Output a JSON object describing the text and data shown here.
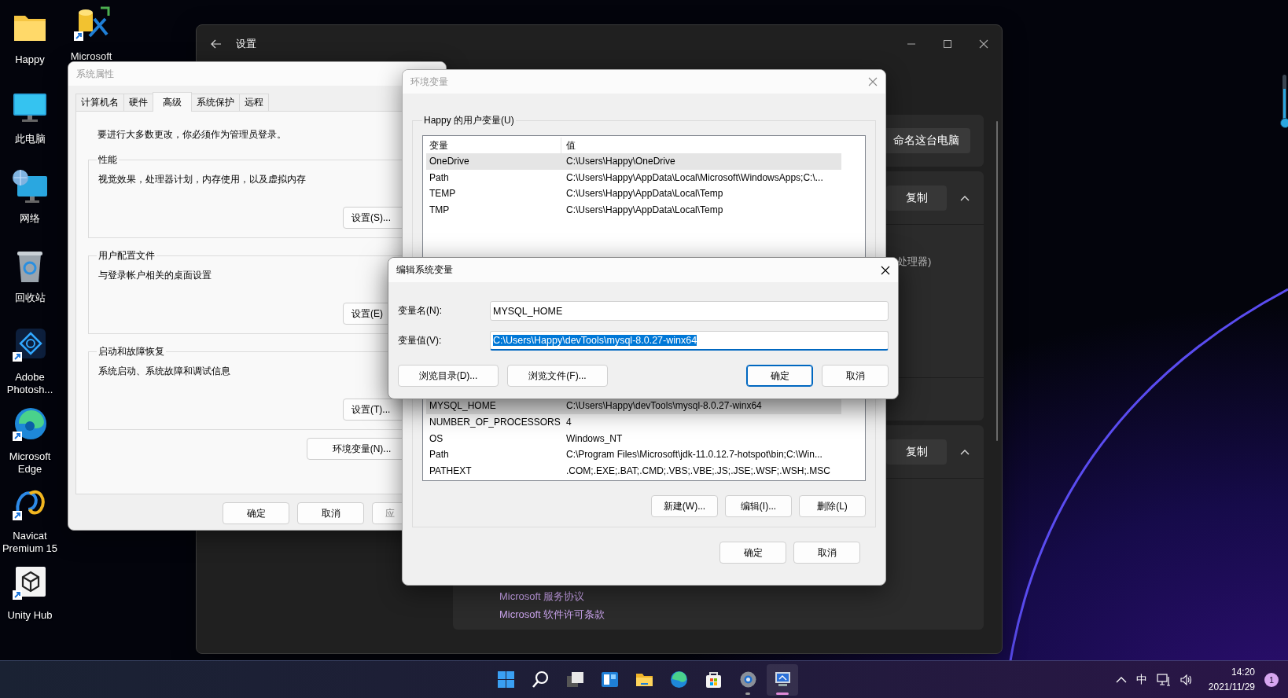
{
  "desktop_icons": [
    {
      "label": "Happy",
      "kind": "folder",
      "shortcut": false
    },
    {
      "label": "此电脑",
      "kind": "computer",
      "shortcut": false
    },
    {
      "label": "网络",
      "kind": "network",
      "shortcut": false
    },
    {
      "label": "回收站",
      "kind": "recycle-bin",
      "shortcut": false
    },
    {
      "label": "Adobe Photosh...",
      "kind": "photoshop",
      "shortcut": true
    },
    {
      "label": "Microsoft Edge",
      "kind": "edge",
      "shortcut": true
    },
    {
      "label": "Navicat Premium 15",
      "kind": "navicat",
      "shortcut": true
    },
    {
      "label": "Unity Hub",
      "kind": "unity",
      "shortcut": true
    }
  ],
  "desktop_icons_second_column": [
    {
      "label": "Microsoft",
      "kind": "database-tools",
      "shortcut": true
    }
  ],
  "settings_window": {
    "title": "设置",
    "rename_button": "命名这台电脑",
    "sections": [
      {
        "button": "复制",
        "expanded": true,
        "detail": "处理器)"
      },
      {
        "button": "复制",
        "expanded": true,
        "links": [
          "Microsoft 服务协议",
          "Microsoft 软件许可条款"
        ]
      }
    ]
  },
  "system_properties": {
    "title": "系统属性",
    "active": false,
    "tabs": [
      {
        "label": "计算机名",
        "selected": false
      },
      {
        "label": "硬件",
        "selected": false
      },
      {
        "label": "高级",
        "selected": true
      },
      {
        "label": "系统保护",
        "selected": false
      },
      {
        "label": "远程",
        "selected": false
      }
    ],
    "notice": "要进行大多数更改，你必须作为管理员登录。",
    "groups": [
      {
        "title": "性能",
        "text": "视觉效果，处理器计划，内存使用，以及虚拟内存",
        "button": "设置(S)..."
      },
      {
        "title": "用户配置文件",
        "text": "与登录帐户相关的桌面设置",
        "button": "设置(E)"
      },
      {
        "title": "启动和故障恢复",
        "text": "系统启动、系统故障和调试信息",
        "button": "设置(T)..."
      }
    ],
    "env_button": "环境变量(N)...",
    "buttons": [
      {
        "label": "确定",
        "disabled": false
      },
      {
        "label": "取消",
        "disabled": false
      },
      {
        "label": "应",
        "disabled": true
      }
    ]
  },
  "environment_variables": {
    "title": "环境变量",
    "active": false,
    "user_group": "Happy 的用户变量(U)",
    "user_columns": [
      "变量",
      "值"
    ],
    "user_rows": [
      {
        "name": "OneDrive",
        "value": "C:\\Users\\Happy\\OneDrive",
        "selected": true
      },
      {
        "name": "Path",
        "value": "C:\\Users\\Happy\\AppData\\Local\\Microsoft\\WindowsApps;C:\\...",
        "selected": false
      },
      {
        "name": "TEMP",
        "value": "C:\\Users\\Happy\\AppData\\Local\\Temp",
        "selected": false
      },
      {
        "name": "TMP",
        "value": "C:\\Users\\Happy\\AppData\\Local\\Temp",
        "selected": false
      }
    ],
    "system_rows": [
      {
        "name": "MYSQL_HOME",
        "value": "C:\\Users\\Happy\\devTools\\mysql-8.0.27-winx64",
        "selected": true
      },
      {
        "name": "NUMBER_OF_PROCESSORS",
        "value": "4",
        "selected": false
      },
      {
        "name": "OS",
        "value": "Windows_NT",
        "selected": false
      },
      {
        "name": "Path",
        "value": "C:\\Program Files\\Microsoft\\jdk-11.0.12.7-hotspot\\bin;C:\\Win...",
        "selected": false
      },
      {
        "name": "PATHEXT",
        "value": ".COM;.EXE;.BAT;.CMD;.VBS;.VBE;.JS;.JSE;.WSF;.WSH;.MSC",
        "selected": false
      }
    ],
    "system_buttons": [
      "新建(W)...",
      "编辑(I)...",
      "删除(L)"
    ],
    "buttons": [
      "确定",
      "取消"
    ]
  },
  "edit_dialog": {
    "title": "编辑系统变量",
    "active": true,
    "fields": [
      {
        "label": "变量名(N):",
        "value": "MYSQL_HOME",
        "focused": false,
        "selected": false
      },
      {
        "label": "变量值(V):",
        "value": "C:\\Users\\Happy\\devTools\\mysql-8.0.27-winx64",
        "focused": true,
        "selected": true
      }
    ],
    "left_buttons": [
      {
        "label": "浏览目录(D)...",
        "default": false
      },
      {
        "label": "浏览文件(F)...",
        "default": false
      }
    ],
    "right_buttons": [
      {
        "label": "确定",
        "default": true
      },
      {
        "label": "取消",
        "default": false
      }
    ]
  },
  "taskbar": {
    "apps": [
      {
        "kind": "start",
        "running": false,
        "active": false
      },
      {
        "kind": "search",
        "running": false,
        "active": false
      },
      {
        "kind": "task-view",
        "running": false,
        "active": false
      },
      {
        "kind": "widgets",
        "running": false,
        "active": false
      },
      {
        "kind": "file-explorer",
        "running": false,
        "active": false
      },
      {
        "kind": "edge",
        "running": false,
        "active": false
      },
      {
        "kind": "store",
        "running": false,
        "active": false
      },
      {
        "kind": "settings",
        "running": true,
        "active": false
      },
      {
        "kind": "system-properties",
        "running": true,
        "active": true
      }
    ],
    "input_method": "中",
    "time": "14:20",
    "date": "2021/11/29",
    "notification_count": "1"
  }
}
